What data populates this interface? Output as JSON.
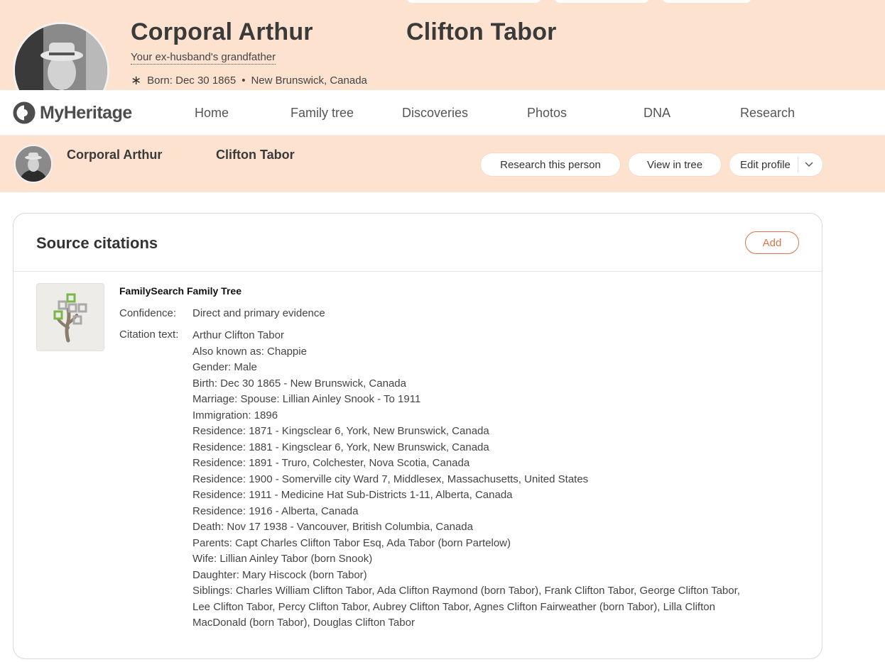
{
  "hero": {
    "first_name": "Corporal Arthur",
    "last_name": "Clifton Tabor",
    "relation": "Your ex-husband's grandfather",
    "born_label": "Born:",
    "born_date": "Dec 30 1865",
    "born_separator": "•",
    "born_place": "New Brunswick, Canada"
  },
  "navbar": {
    "logo_text": "MyHeritage",
    "items": [
      "Home",
      "Family tree",
      "Discoveries",
      "Photos",
      "DNA",
      "Research"
    ]
  },
  "personbar": {
    "first_name": "Corporal Arthur",
    "last_name": "Clifton Tabor",
    "research_label": "Research this person",
    "view_tree_label": "View in tree",
    "edit_label": "Edit profile"
  },
  "citations": {
    "title": "Source citations",
    "add_label": "Add",
    "source_title": "FamilySearch Family Tree",
    "confidence_label": "Confidence:",
    "confidence_value": "Direct and primary evidence",
    "citation_label": "Citation text:",
    "lines": [
      "Arthur Clifton Tabor",
      "Also known as: Chappie",
      "Gender: Male",
      "Birth: Dec 30 1865 - New Brunswick, Canada",
      "Marriage: Spouse: Lillian Ainley Snook - To 1911",
      "Immigration: 1896",
      "Residence: 1871 - Kingsclear 6, York, New Brunswick, Canada",
      "Residence: 1881 - Kingsclear 6, York, New Brunswick, Canada",
      "Residence: 1891 - Truro, Colchester, Nova Scotia, Canada",
      "Residence: 1900 - Somerville city Ward 7, Middlesex, Massachusetts, United States",
      "Residence: 1911 - Medicine Hat Sub-Districts 1-11, Alberta, Canada",
      "Residence: 1916 - Alberta, Canada",
      "Death: Nov 17 1938 - Vancouver, British Columbia, Canada",
      "Parents: Capt Charles Clifton Tabor Esq, Ada Tabor (born Partelow)",
      "Wife: Lillian Ainley Tabor (born Snook)",
      "Daughter: Mary Hiscock (born Tabor)",
      "Siblings: Charles William Clifton Tabor, Ada Clifton Raymond (born Tabor), Frank Clifton Tabor, George Clifton Tabor, Lee Clifton Tabor, Percy Clifton Tabor, Aubrey Clifton Tabor, Agnes Clifton Fairweather (born Tabor), Lilla Clifton MacDonald (born Tabor), Douglas Clifton Tabor"
    ]
  },
  "colors": {
    "peach": "#fde2cf",
    "accent_orange": "#d9734a",
    "tree_green": "#7ab648"
  }
}
